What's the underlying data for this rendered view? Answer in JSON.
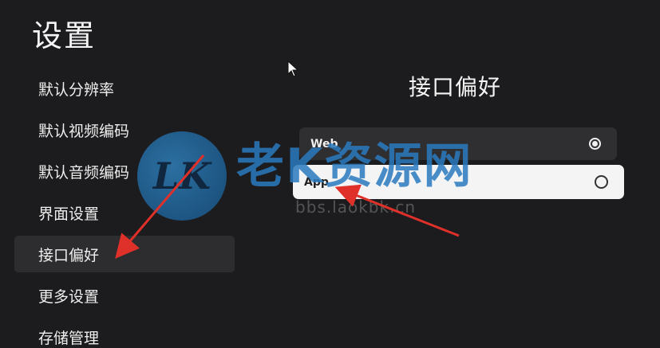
{
  "page": {
    "title": "设置"
  },
  "sidebar": {
    "items": [
      {
        "label": "默认分辨率",
        "active": false
      },
      {
        "label": "默认视频编码",
        "active": false
      },
      {
        "label": "默认音频编码",
        "active": false
      },
      {
        "label": "界面设置",
        "active": false
      },
      {
        "label": "接口偏好",
        "active": true
      },
      {
        "label": "更多设置",
        "active": false
      },
      {
        "label": "存储管理",
        "active": false
      }
    ]
  },
  "main": {
    "section_title": "接口偏好",
    "options": [
      {
        "label": "Web",
        "selected": true,
        "focused": false
      },
      {
        "label": "App",
        "selected": false,
        "focused": true
      }
    ]
  },
  "watermark": {
    "logo_text": "LK",
    "text": "老K资源网",
    "url": "bbs.laokbk.cn"
  },
  "colors": {
    "background": "#1c1c1e",
    "active_item": "#2d2d30",
    "focused_option": "#f4f4f4",
    "annotation_arrow": "#e0302a",
    "watermark_blue": "#2b7bc0"
  }
}
